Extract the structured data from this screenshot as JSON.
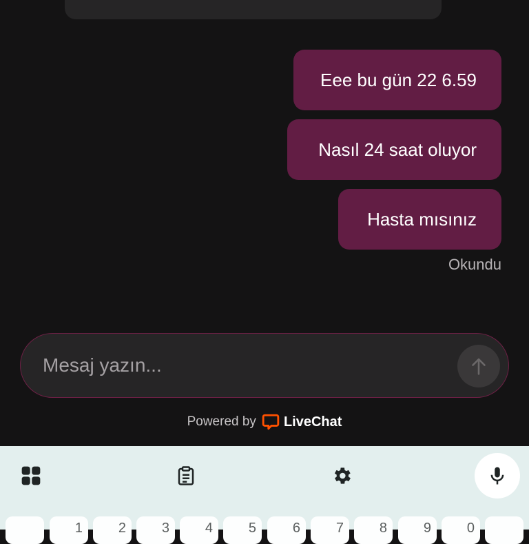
{
  "messages": [
    {
      "text": "Eee bu gün 22 6.59"
    },
    {
      "text": "Nasıl 24 saat oluyor"
    },
    {
      "text": "Hasta mısınız"
    }
  ],
  "read_status": "Okundu",
  "composer": {
    "placeholder": "Mesaj yazın..."
  },
  "footer": {
    "powered_by": "Powered by",
    "brand": "LiveChat"
  },
  "keyboard": {
    "toolbar_icons": [
      "apps-grid-icon",
      "clipboard-icon",
      "settings-gear-icon",
      "mic-icon"
    ],
    "number_keys": [
      "",
      "1",
      "2",
      "3",
      "4",
      "5",
      "6",
      "7",
      "8",
      "9",
      "0",
      ""
    ]
  },
  "colors": {
    "background": "#141314",
    "bubble": "#621d44",
    "composer_border": "#6d2045",
    "keyboard_bg": "#e3efee",
    "livechat_orange": "#ff5100"
  }
}
